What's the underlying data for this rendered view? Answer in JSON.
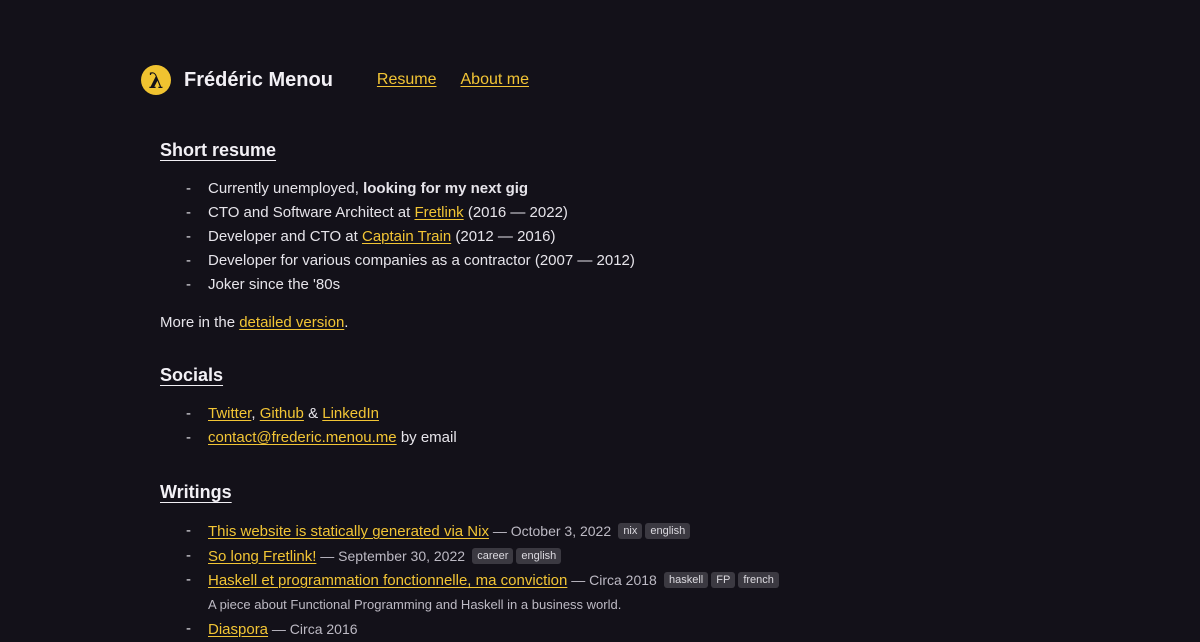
{
  "header": {
    "logo_glyph": "λ",
    "site_name": "Frédéric Menou",
    "nav": [
      {
        "label": "Resume"
      },
      {
        "label": "About me"
      }
    ]
  },
  "resume": {
    "title": "Short resume",
    "items": [
      {
        "text_before": "Currently unemployed, ",
        "bold": "looking for my next gig"
      },
      {
        "text_before": "CTO and Software Architect at ",
        "link": "Fretlink",
        "text_after": " (2016 — 2022)"
      },
      {
        "text_before": "Developer and CTO at ",
        "link": "Captain Train",
        "text_after": " (2012 — 2016)"
      },
      {
        "text_before": "Developer for various companies as a contractor (2007 — 2012)"
      },
      {
        "text_before": "Joker since the '80s"
      }
    ],
    "more_prefix": "More in the ",
    "more_link": "detailed version",
    "more_suffix": "."
  },
  "socials": {
    "title": "Socials",
    "twitter": "Twitter",
    "sep1": ", ",
    "github": "Github",
    "sep2": " & ",
    "linkedin": "LinkedIn",
    "email": "contact@frederic.menou.me",
    "email_suffix": " by email"
  },
  "writings": {
    "title": "Writings",
    "items": [
      {
        "title": "This website is statically generated via Nix",
        "date": " — October 3, 2022",
        "tags": [
          "nix",
          "english"
        ]
      },
      {
        "title": "So long Fretlink!",
        "date": " — September 30, 2022",
        "tags": [
          "career",
          "english"
        ]
      },
      {
        "title": "Haskell et programmation fonctionnelle, ma conviction",
        "date": " — Circa 2018",
        "tags": [
          "haskell",
          "FP",
          "french"
        ],
        "description": "A piece about Functional Programming and Haskell in a business world."
      },
      {
        "title": "Diaspora",
        "date": " — Circa 2016",
        "tags": [
          "",
          ""
        ]
      }
    ]
  },
  "colors": {
    "background": "#131119",
    "accent": "#f2c535",
    "tag_bg": "#3b3941"
  }
}
